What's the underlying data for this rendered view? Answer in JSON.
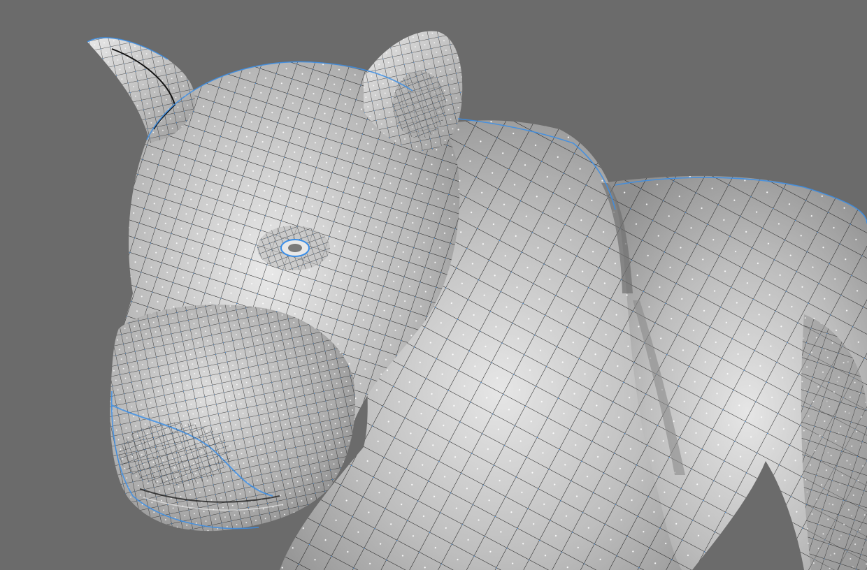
{
  "viewport": {
    "background_color": "#6b6b6b",
    "mesh_face_color": "#cfcfcf",
    "mesh_shadow_color": "#9a9a9a",
    "mesh_highlight_color": "#ececec",
    "edge_color": "#1a1a1a",
    "vertex_color": "#3a8ee8",
    "face_dot_color": "#ffffff",
    "subject_icon": "lion-mesh-icon"
  }
}
